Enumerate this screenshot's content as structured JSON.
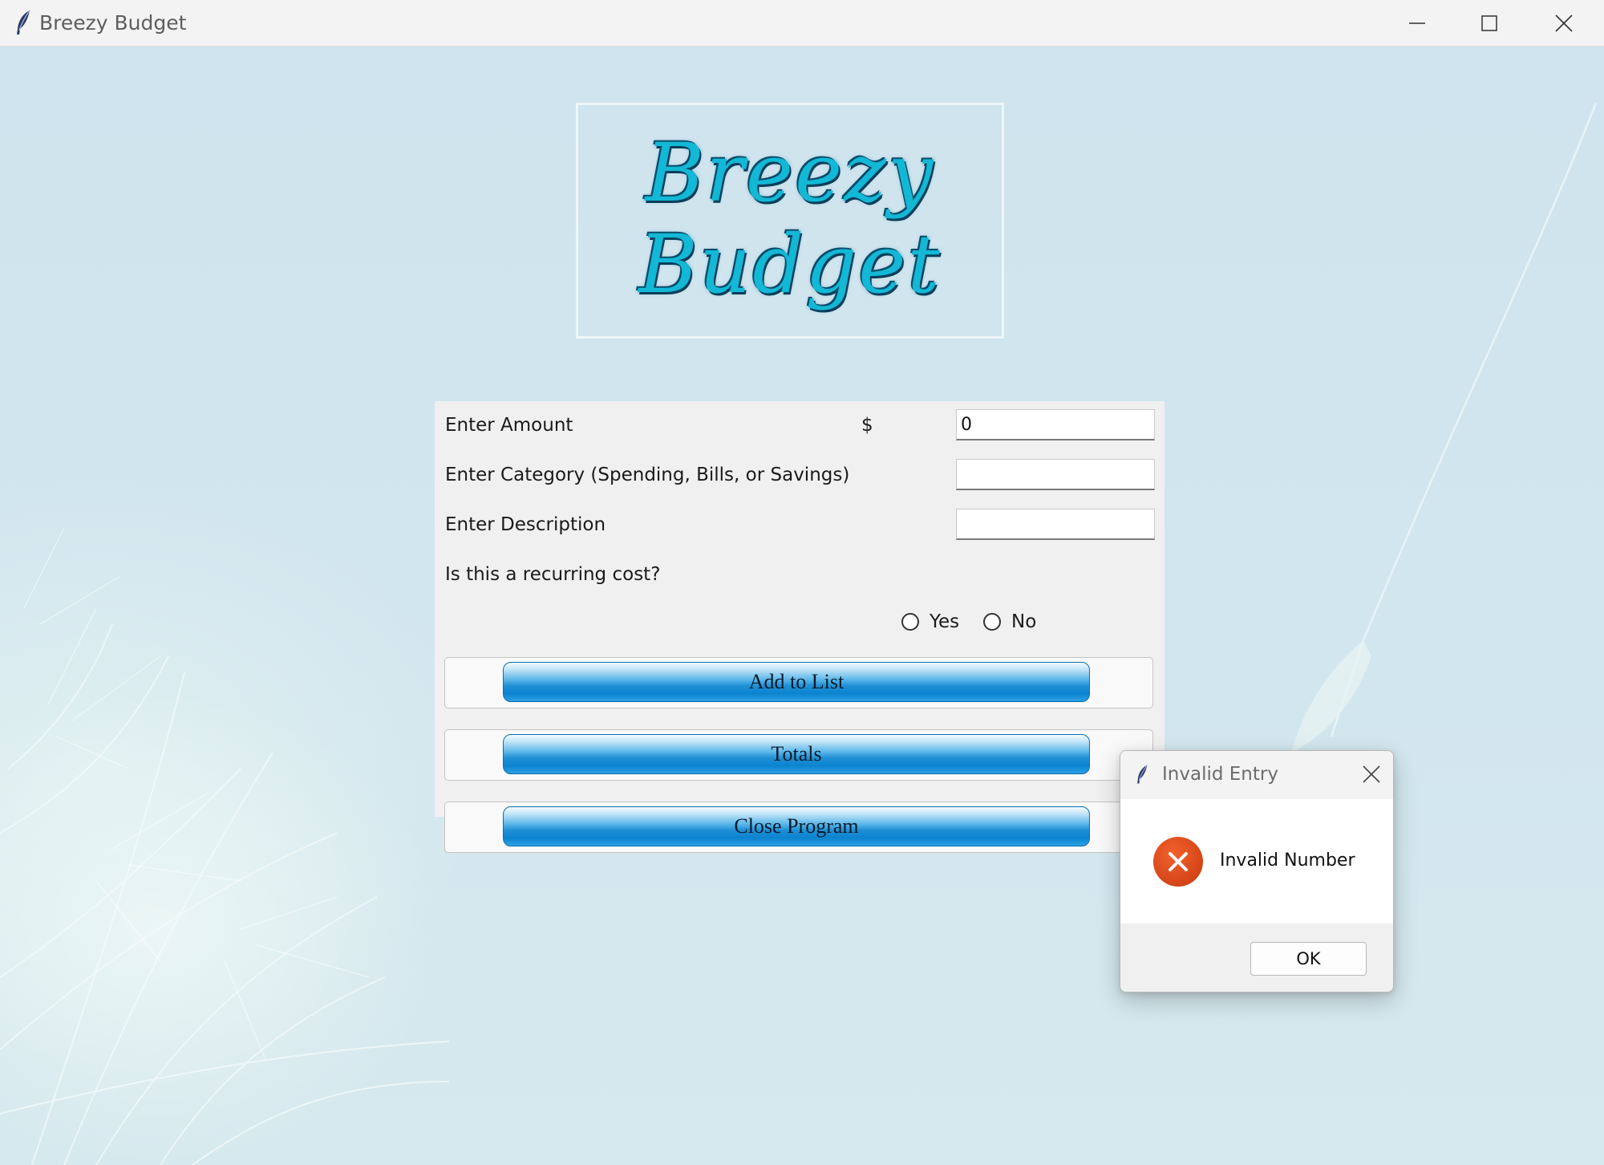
{
  "window": {
    "title": "Breezy Budget",
    "icon": "feather-icon",
    "controls": [
      "minimize-icon",
      "maximize-icon",
      "close-icon"
    ]
  },
  "logo": {
    "line1": "Breezy",
    "line2": "Budget"
  },
  "form": {
    "amount_label": "Enter Amount",
    "currency_symbol": "$",
    "amount_value": "0",
    "category_label": "Enter Category (Spending, Bills, or Savings)",
    "category_value": "",
    "description_label": "Enter Description",
    "description_value": "",
    "recurring_label": "Is this a recurring cost?",
    "radio_yes": "Yes",
    "radio_no": "No",
    "add_button": "Add to List",
    "totals_button": "Totals",
    "close_button": "Close Program"
  },
  "dialog": {
    "title": "Invalid Entry",
    "message": "Invalid Number",
    "ok_label": "OK",
    "icon": "error-icon"
  },
  "colors": {
    "accent": "#1f8fd5",
    "error": "#d9481a",
    "logo": "#12b8d6",
    "background": "#cfe4ee"
  }
}
